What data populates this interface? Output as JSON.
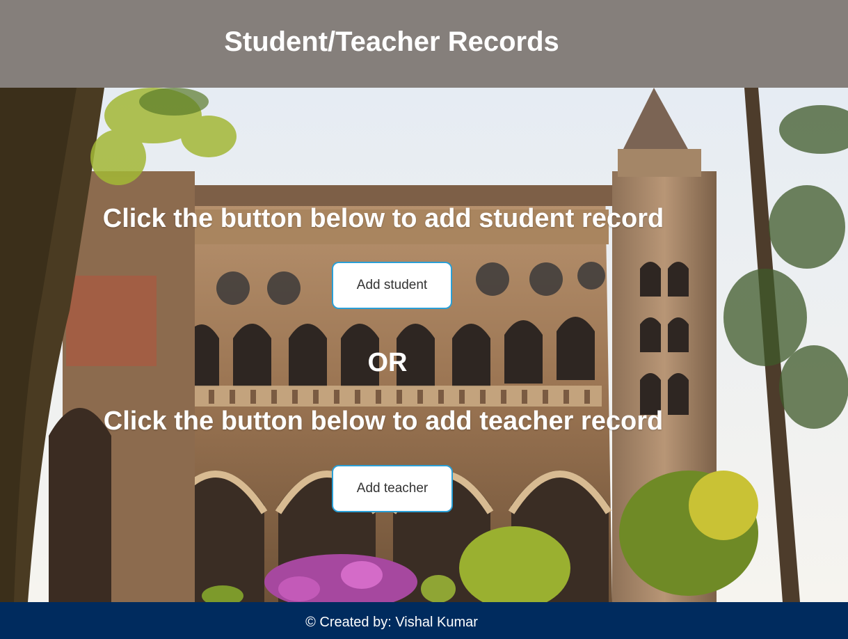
{
  "header": {
    "title": "Student/Teacher Records"
  },
  "main": {
    "student_prompt": "Click the button below to add student record",
    "student_button_label": "Add student",
    "or_label": "OR",
    "teacher_prompt": "Click the button below to add teacher record",
    "teacher_button_label": "Add teacher"
  },
  "footer": {
    "credit": "© Created by: Vishal Kumar"
  },
  "colors": {
    "header_bg": "#857f7b",
    "footer_bg": "#002b5e",
    "button_border": "#2a9fd6",
    "text_light": "#ffffff"
  },
  "background_image": {
    "subject": "university-building-photo"
  }
}
